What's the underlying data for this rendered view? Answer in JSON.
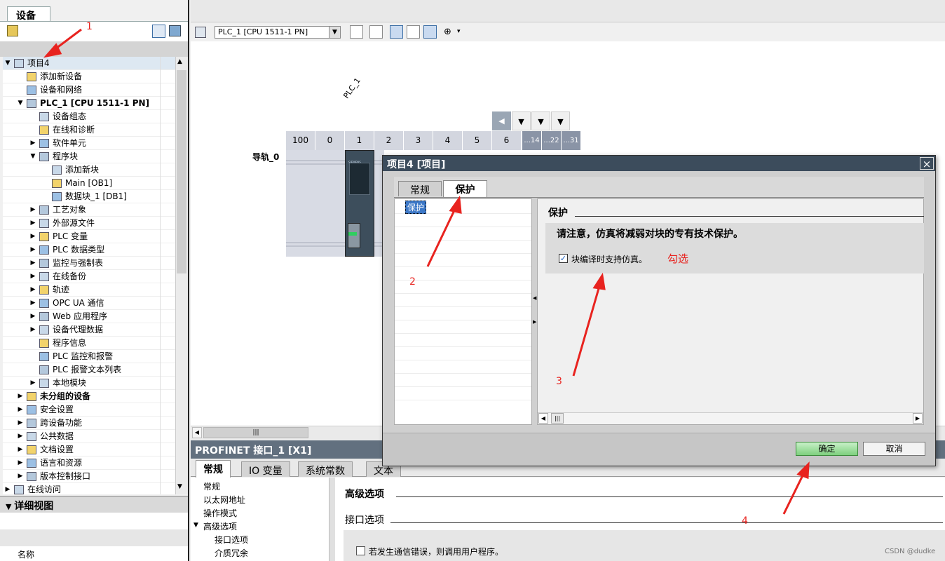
{
  "left_panel": {
    "tab": "设备",
    "tree": [
      {
        "label": "项目4",
        "level": 0,
        "arrow": "▼",
        "bold": false,
        "selected": true
      },
      {
        "label": "添加新设备",
        "level": 1,
        "arrow": "",
        "bold": false
      },
      {
        "label": "设备和网络",
        "level": 1,
        "arrow": "",
        "bold": false
      },
      {
        "label": "PLC_1 [CPU 1511-1 PN]",
        "level": 1,
        "arrow": "▼",
        "bold": true
      },
      {
        "label": "设备组态",
        "level": 2,
        "arrow": "",
        "bold": false
      },
      {
        "label": "在线和诊断",
        "level": 2,
        "arrow": "",
        "bold": false
      },
      {
        "label": "软件单元",
        "level": 2,
        "arrow": "▶",
        "bold": false
      },
      {
        "label": "程序块",
        "level": 2,
        "arrow": "▼",
        "bold": false
      },
      {
        "label": "添加新块",
        "level": 3,
        "arrow": "",
        "bold": false
      },
      {
        "label": "Main [OB1]",
        "level": 3,
        "arrow": "",
        "bold": false
      },
      {
        "label": "数据块_1 [DB1]",
        "level": 3,
        "arrow": "",
        "bold": false
      },
      {
        "label": "工艺对象",
        "level": 2,
        "arrow": "▶",
        "bold": false
      },
      {
        "label": "外部源文件",
        "level": 2,
        "arrow": "▶",
        "bold": false
      },
      {
        "label": "PLC 变量",
        "level": 2,
        "arrow": "▶",
        "bold": false
      },
      {
        "label": "PLC 数据类型",
        "level": 2,
        "arrow": "▶",
        "bold": false
      },
      {
        "label": "监控与强制表",
        "level": 2,
        "arrow": "▶",
        "bold": false
      },
      {
        "label": "在线备份",
        "level": 2,
        "arrow": "▶",
        "bold": false
      },
      {
        "label": "轨迹",
        "level": 2,
        "arrow": "▶",
        "bold": false
      },
      {
        "label": "OPC UA 通信",
        "level": 2,
        "arrow": "▶",
        "bold": false
      },
      {
        "label": "Web 应用程序",
        "level": 2,
        "arrow": "▶",
        "bold": false
      },
      {
        "label": "设备代理数据",
        "level": 2,
        "arrow": "▶",
        "bold": false
      },
      {
        "label": "程序信息",
        "level": 2,
        "arrow": "",
        "bold": false
      },
      {
        "label": "PLC 监控和报警",
        "level": 2,
        "arrow": "",
        "bold": false
      },
      {
        "label": "PLC 报警文本列表",
        "level": 2,
        "arrow": "",
        "bold": false
      },
      {
        "label": "本地模块",
        "level": 2,
        "arrow": "▶",
        "bold": false
      },
      {
        "label": "未分组的设备",
        "level": 1,
        "arrow": "▶",
        "bold": true
      },
      {
        "label": "安全设置",
        "level": 1,
        "arrow": "▶",
        "bold": false
      },
      {
        "label": "跨设备功能",
        "level": 1,
        "arrow": "▶",
        "bold": false
      },
      {
        "label": "公共数据",
        "level": 1,
        "arrow": "▶",
        "bold": false
      },
      {
        "label": "文档设置",
        "level": 1,
        "arrow": "▶",
        "bold": false
      },
      {
        "label": "语言和资源",
        "level": 1,
        "arrow": "▶",
        "bold": false
      },
      {
        "label": "版本控制接口",
        "level": 1,
        "arrow": "▶",
        "bold": false
      },
      {
        "label": "在线访问",
        "level": 0,
        "arrow": "▶",
        "bold": false
      }
    ],
    "detail_view": {
      "title": "详细视图",
      "column": "名称"
    }
  },
  "device_view": {
    "device_select": "PLC_1 [CPU 1511-1 PN]",
    "plc_label": "PLC_1",
    "rail_label": "导轨_0",
    "slots": [
      "100",
      "0",
      "1",
      "2",
      "3",
      "4",
      "5",
      "6"
    ],
    "slots_ext": [
      "...14",
      "...22",
      "...31"
    ],
    "cpu_brand": "SIEMENS"
  },
  "inspector": {
    "title": "PROFINET 接口_1 [X1]",
    "tabs": [
      "常规",
      "IO 变量",
      "系统常数",
      "文本"
    ],
    "nav": [
      {
        "label": "常规",
        "indent": 0,
        "arrow": ""
      },
      {
        "label": "以太网地址",
        "indent": 0,
        "arrow": ""
      },
      {
        "label": "操作模式",
        "indent": 0,
        "arrow": ""
      },
      {
        "label": "高级选项",
        "indent": 0,
        "arrow": "▼"
      },
      {
        "label": "接口选项",
        "indent": 1,
        "arrow": ""
      },
      {
        "label": "介质冗余",
        "indent": 1,
        "arrow": ""
      }
    ],
    "section_advanced": "高级选项",
    "section_interface": "接口选项",
    "comm_error_option": "若发生通信错误，则调用用户程序。"
  },
  "dialog": {
    "title": "项目4 [项目]",
    "close_icon": "×",
    "tabs": [
      "常规",
      "保护"
    ],
    "nav_item": "保护",
    "section_title": "保护",
    "note": "请注意，仿真将减弱对块的专有技术保护。",
    "sim_checkbox_label": "块编译时支持仿真。",
    "sim_checkbox_checked": true,
    "ok": "确定",
    "cancel": "取消"
  },
  "annotations": {
    "n1": "1",
    "n2": "2",
    "n3": "3",
    "n4": "4",
    "check_hint": "勾选",
    "color": "#e8231f"
  },
  "watermark": "CSDN @dudke"
}
